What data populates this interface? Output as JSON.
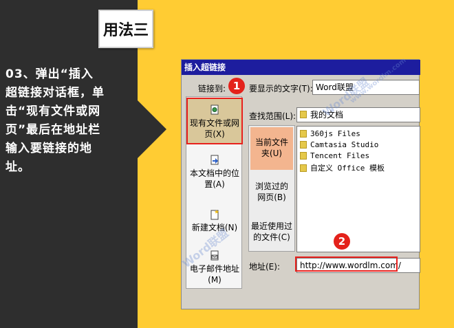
{
  "badge": {
    "title": "用法三"
  },
  "description": {
    "lines": [
      "03、弹出“插入",
      "超链接对话框，单",
      "击“现有文件或网",
      "页”最后在地址栏",
      "输入要链接的地",
      "址。"
    ]
  },
  "dialog": {
    "title": "插入超链接",
    "link_to_label": "链接到:",
    "display_text_label": "要显示的文字(T):",
    "display_text_value": "Word联盟",
    "look_in_label": "查找范围(L):",
    "look_in_value": "我的文档",
    "address_label": "地址(E):",
    "address_value": "http://www.wordlm.com/",
    "link_items": [
      {
        "line1": "现有文件或网",
        "line2": "页(X)"
      },
      {
        "line1": "本文档中的位",
        "line2": "置(A)"
      },
      {
        "line1": "新建文档(N)",
        "line2": ""
      },
      {
        "line1": "电子邮件地址",
        "line2": "(M)"
      }
    ],
    "lookin_items": [
      {
        "line1": "当前文件",
        "line2": "夹(U)"
      },
      {
        "line1": "浏览过的",
        "line2": "网页(B)"
      },
      {
        "line1": "最近使用过",
        "line2": "的文件(C)"
      }
    ],
    "files": [
      "360js Files",
      "Camtasia Studio",
      "Tencent Files",
      "自定义 Office 模板"
    ]
  },
  "markers": {
    "one": "1",
    "two": "2"
  },
  "watermark": {
    "text1": "Word联盟",
    "text2": "www.wordlm.com"
  },
  "colors": {
    "accent_yellow": "#ffcc33",
    "dark_bg": "#2e2e2e",
    "highlight_red": "#e8201c"
  }
}
